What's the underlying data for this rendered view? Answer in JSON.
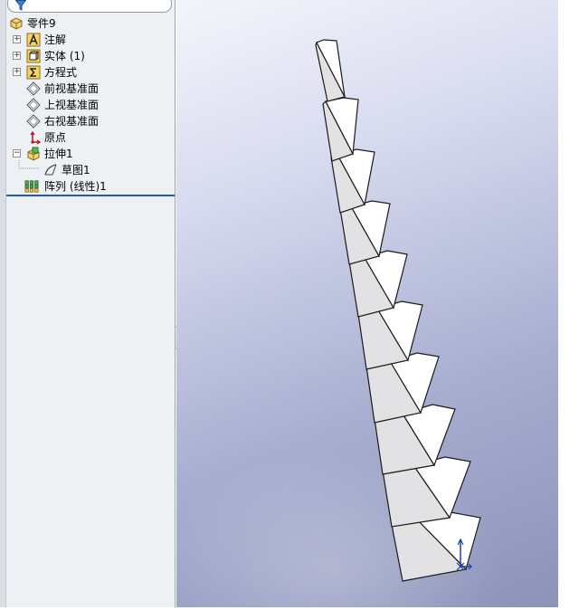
{
  "feature_tree": {
    "root": {
      "label": "零件9",
      "icon": "part-icon"
    },
    "items": [
      {
        "label": "注解",
        "icon": "annotations-icon",
        "expandable": true,
        "expanded": false
      },
      {
        "label": "实体 (1)",
        "icon": "solid-bodies-icon",
        "expandable": true,
        "expanded": false
      },
      {
        "label": "方程式",
        "icon": "equations-icon",
        "expandable": true,
        "expanded": false
      },
      {
        "label": "前视基准面",
        "icon": "plane-icon",
        "expandable": false
      },
      {
        "label": "上视基准面",
        "icon": "plane-icon",
        "expandable": false
      },
      {
        "label": "右视基准面",
        "icon": "plane-icon",
        "expandable": false
      },
      {
        "label": "原点",
        "icon": "origin-icon",
        "expandable": false
      },
      {
        "label": "拉伸1",
        "icon": "extrude-icon",
        "expandable": true,
        "expanded": true
      },
      {
        "label": "草图1",
        "icon": "sketch-icon",
        "expandable": false,
        "child": true
      },
      {
        "label": "阵列 (线性)1",
        "icon": "linear-pattern-icon",
        "expandable": false
      }
    ]
  },
  "colors": {
    "panel_bg": "#eef1f4",
    "accent_line": "#1f5fa8",
    "model_face_light": "#ffffff",
    "model_face_shade": "#e2e2e4",
    "model_edge": "#1a1a1a"
  }
}
